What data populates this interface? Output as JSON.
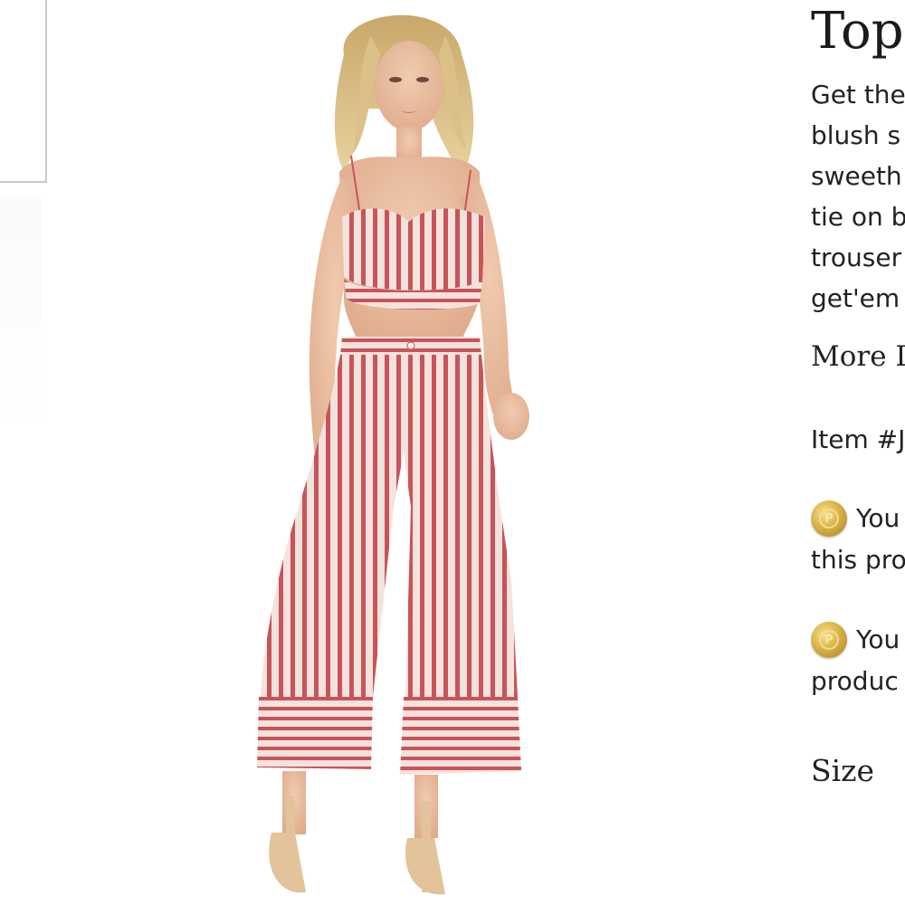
{
  "product": {
    "title": "Top",
    "description_lines": [
      "Get the",
      "blush s",
      "sweeth",
      "tie on b",
      "trouser",
      "get'em"
    ],
    "more_link": "More D",
    "item_number": "Item #J",
    "points_1": [
      "You",
      "this pro"
    ],
    "points_2": [
      "You",
      "produc"
    ],
    "size_label": "Size",
    "coin_icon_letter": "P"
  },
  "colors": {
    "stripe_red": "#c9545a",
    "stripe_light": "#f2dcd6",
    "coin_gold": "#d9b24a"
  }
}
